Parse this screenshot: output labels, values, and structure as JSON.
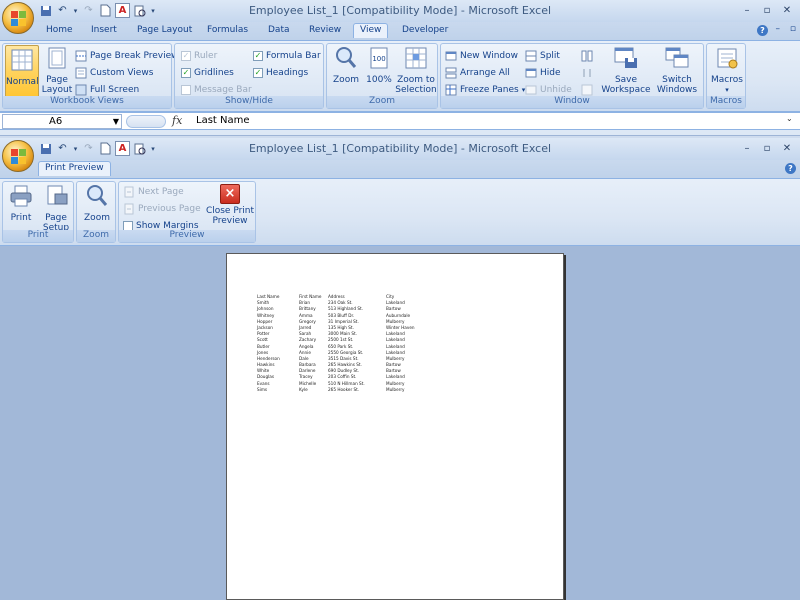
{
  "window1": {
    "title": "Employee List_1  [Compatibility Mode] - Microsoft Excel",
    "tabs": [
      "Home",
      "Insert",
      "Page Layout",
      "Formulas",
      "Data",
      "Review",
      "View",
      "Developer"
    ],
    "active_tab": "View",
    "groups": {
      "workbook_views": {
        "label": "Workbook Views",
        "normal": "Normal",
        "page_layout": "Page Layout",
        "page_break_preview": "Page Break Preview",
        "custom_views": "Custom Views",
        "full_screen": "Full Screen"
      },
      "show_hide": {
        "label": "Show/Hide",
        "ruler": "Ruler",
        "gridlines": "Gridlines",
        "message_bar": "Message Bar",
        "formula_bar": "Formula Bar",
        "headings": "Headings"
      },
      "zoom": {
        "label": "Zoom",
        "zoom": "Zoom",
        "hundred": "100%",
        "zoom_to_selection": "Zoom to Selection"
      },
      "window": {
        "label": "Window",
        "new_window": "New Window",
        "arrange_all": "Arrange All",
        "freeze_panes": "Freeze Panes",
        "split": "Split",
        "hide": "Hide",
        "unhide": "Unhide",
        "save_workspace": "Save Workspace",
        "switch_windows": "Switch Windows"
      },
      "macros": {
        "label": "Macros",
        "macros": "Macros"
      }
    },
    "formula_bar": {
      "name_box": "A6",
      "fx": "fx",
      "value": "Last Name"
    }
  },
  "window2": {
    "title": "Employee List_1  [Compatibility Mode] - Microsoft Excel",
    "tab": "Print Preview",
    "groups": {
      "print": {
        "label": "Print",
        "print": "Print",
        "page_setup": "Page Setup"
      },
      "zoom": {
        "label": "Zoom",
        "zoom": "Zoom"
      },
      "preview": {
        "label": "Preview",
        "next_page": "Next Page",
        "previous_page": "Previous Page",
        "show_margins": "Show Margins",
        "close_print_preview": "Close Print Preview"
      }
    }
  },
  "sheet": {
    "headers": [
      "Last Name",
      "First Name",
      "Address",
      "City"
    ],
    "rows": [
      [
        "Smith",
        "Brian",
        "234 Oak St.",
        "Lakeland"
      ],
      [
        "Johnson",
        "Brittany",
        "513 Highland St.",
        "Bartow"
      ],
      [
        "Whitney",
        "Amma",
        "503 Bluff Dr.",
        "Auburndale"
      ],
      [
        "Hopper",
        "Gregory",
        "31 Imperial St.",
        "Mulberry"
      ],
      [
        "Jackson",
        "Jarred",
        "135 High St.",
        "Winter Haven"
      ],
      [
        "Potter",
        "Sarah",
        "3000 Main St.",
        "Lakeland"
      ],
      [
        "Scott",
        "Zachary",
        "2500 1st St.",
        "Lakeland"
      ],
      [
        "Butler",
        "Angela",
        "650 Park St.",
        "Lakeland"
      ],
      [
        "Jones",
        "Annie",
        "2550 Georgia St.",
        "Lakeland"
      ],
      [
        "Henderson",
        "Dale",
        "3515 Davis St.",
        "Mulberry"
      ],
      [
        "Hawkins",
        "Barbara",
        "265 Hawkins St.",
        "Bartow"
      ],
      [
        "White",
        "Darlene",
        "690 Dudley St.",
        "Bartow"
      ],
      [
        "Douglas",
        "Tracey",
        "203 Coffin St.",
        "Lakeland"
      ],
      [
        "Evans",
        "Michelle",
        "510 N Hillman St.",
        "Mulberry"
      ],
      [
        "Sims",
        "Kyle",
        "265 Hooker St.",
        "Mulberry"
      ]
    ]
  },
  "colors": {
    "ribbon_bg": "#dbe6f4",
    "title_bg": "#c5d7ee",
    "preview_bg": "#a2b8d8",
    "close_preview_red": "#d93a2b"
  }
}
